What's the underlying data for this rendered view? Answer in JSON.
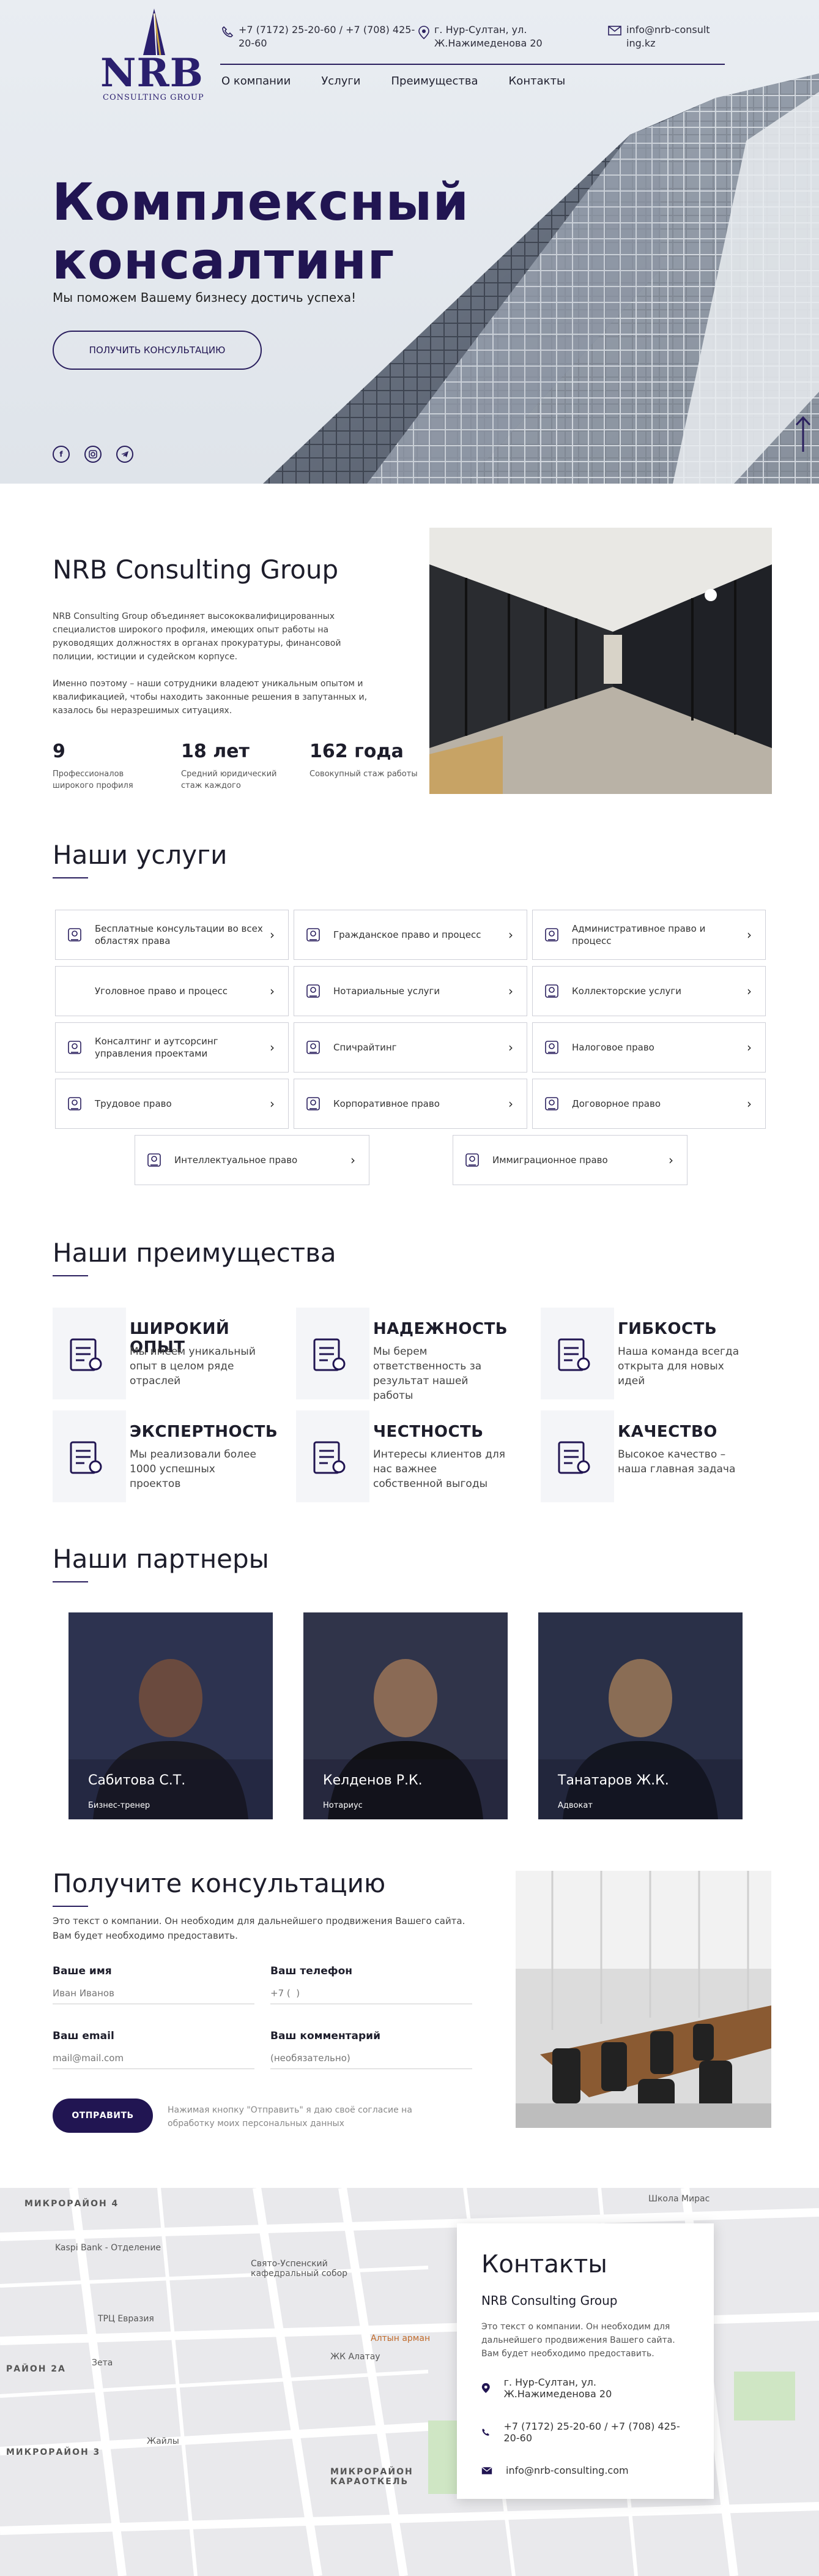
{
  "header": {
    "logo_text": "NRB",
    "logo_sub": "CONSULTING GROUP",
    "phones": "+7 (7172) 25-20-60 / +7 (708) 425-20-60",
    "address": "г. Нур-Султан, ул. Ж.Нажимеденова 20",
    "email": "info@nrb-consulting.kz",
    "nav": [
      "О компании",
      "Услуги",
      "Преимущества",
      "Контакты"
    ]
  },
  "hero": {
    "title_line1": "Комплексный",
    "title_line2": "консалтинг",
    "subtitle": "Мы поможем Вашему бизнесу достичь успеха!",
    "cta": "ПОЛУЧИТЬ КОНСУЛЬТАЦИЮ",
    "socials": [
      "facebook-icon",
      "instagram-icon",
      "telegram-icon"
    ]
  },
  "about": {
    "title": "NRB Consulting Group",
    "p1": "NRB Consulting Group объединяет высококвалифицированных специалистов широкого профиля, имеющих опыт работы на руководящих должностях в органах прокуратуры, финансовой полиции, юстиции и судейском корпусе.",
    "p2": "Именно поэтому – наши сотрудники владеют уникальным опытом и квалификацией, чтобы находить законные решения в запутанных и, казалось бы неразрешимых ситуациях.",
    "stats": [
      {
        "num": "9",
        "label": "Профессионалов широкого профиля"
      },
      {
        "num": "18 лет",
        "label": "Средний юридический стаж каждого"
      },
      {
        "num": "162 года",
        "label": "Совокупный стаж работы"
      }
    ]
  },
  "services": {
    "title": "Наши услуги",
    "items": [
      {
        "label": "Бесплатные консультации во всех областях права",
        "icon": "consultation-icon"
      },
      {
        "label": "Гражданское право и процесс",
        "icon": "civil-law-icon"
      },
      {
        "label": "Административное право и процесс",
        "icon": "admin-law-icon"
      },
      {
        "label": "Уголовное право и процесс",
        "icon": ""
      },
      {
        "label": "Нотариальные услуги",
        "icon": "notary-icon"
      },
      {
        "label": "Коллекторские услуги",
        "icon": "collector-icon"
      },
      {
        "label": "Консалтинг и аутсорсинг управления проектами",
        "icon": "outsourcing-icon"
      },
      {
        "label": "Спичрайтинг",
        "icon": "speechwriting-icon"
      },
      {
        "label": "Налоговое право",
        "icon": "tax-law-icon"
      },
      {
        "label": "Трудовое право",
        "icon": "labor-law-icon"
      },
      {
        "label": "Корпоративное право",
        "icon": "corporate-law-icon"
      },
      {
        "label": "Договорное право",
        "icon": "contract-law-icon"
      },
      {
        "label": "Интеллектуальное право",
        "icon": "intellectual-law-icon"
      },
      {
        "label": "Иммиграционное право",
        "icon": "immigration-law-icon"
      }
    ]
  },
  "advantages": {
    "title": "Наши преимущества",
    "items": [
      {
        "title": "ШИРОКИЙ ОПЫТ",
        "desc": "Мы имеем уникальный опыт в целом ряде отраслей",
        "icon": "experience-icon"
      },
      {
        "title": "НАДЕЖНОСТЬ",
        "desc": "Мы берем ответственность за результат нашей работы",
        "icon": "briefcase-icon"
      },
      {
        "title": "ГИБКОСТЬ",
        "desc": "Наша команда всегда открыта для новых идей",
        "icon": "flexibility-icon"
      },
      {
        "title": "ЭКСПЕРТНОСТЬ",
        "desc": "Мы реализовали более 1000 успешных проектов",
        "icon": "team-icon"
      },
      {
        "title": "ЧЕСТНОСТЬ",
        "desc": "Интересы клиентов для нас важнее собственной выгоды",
        "icon": "honesty-icon"
      },
      {
        "title": "КАЧЕСТВО",
        "desc": "Высокое качество – наша главная задача",
        "icon": "quality-icon"
      }
    ]
  },
  "partners": {
    "title": "Наши партнеры",
    "items": [
      {
        "name": "Сабитова С.Т.",
        "role": "Бизнес-тренер"
      },
      {
        "name": "Келденов Р.К.",
        "role": "Нотариус"
      },
      {
        "name": "Танатаров Ж.К.",
        "role": "Адвокат"
      }
    ]
  },
  "form": {
    "title": "Получите консультацию",
    "intro": "Это текст о компании. Он необходим для дальнейшего продвижения Вашего сайта. Вам будет необходимо предоставить.",
    "name_label": "Ваше имя",
    "name_ph": "Иван Иванов",
    "phone_label": "Ваш телефон",
    "phone_ph": "+7 (  )",
    "email_label": "Ваш email",
    "email_ph": "mail@mail.com",
    "comment_label": "Ваш комментарий",
    "comment_ph": "(необязательно)",
    "submit": "ОТПРАВИТЬ",
    "agree": "Нажимая кнопку \"Отправить\" я даю своё согласие на обработку моих персональных данных"
  },
  "contacts": {
    "title": "Контакты",
    "company": "NRB Consulting Group",
    "text": "Это текст о компании. Он необходим для дальнейшего продвижения Вашего сайта. Вам будет необходимо предоставить.",
    "address": "г. Нур-Султан, ул. Ж.Нажимеденова 20",
    "phones": "+7 (7172) 25-20-60 / +7 (708) 425-20-60",
    "email": "info@nrb-consulting.com"
  },
  "map": {
    "labels": [
      "МИКРОРАЙОН 4",
      "Kaspi Bank - Отделение",
      "Свято-Успенский кафедральный собор",
      "ТРЦ Евразия",
      "Зета",
      "Алтын арман",
      "ЖК Алатау",
      "РАЙОН 2А",
      "Жайлы",
      "МИКРОРАЙОН 3",
      "МИКРОРАЙОН КАРАОТКЕЛЬ",
      "Школа Мирас"
    ]
  },
  "colors": {
    "primary": "#211552",
    "accent": "#2a1f5e"
  }
}
